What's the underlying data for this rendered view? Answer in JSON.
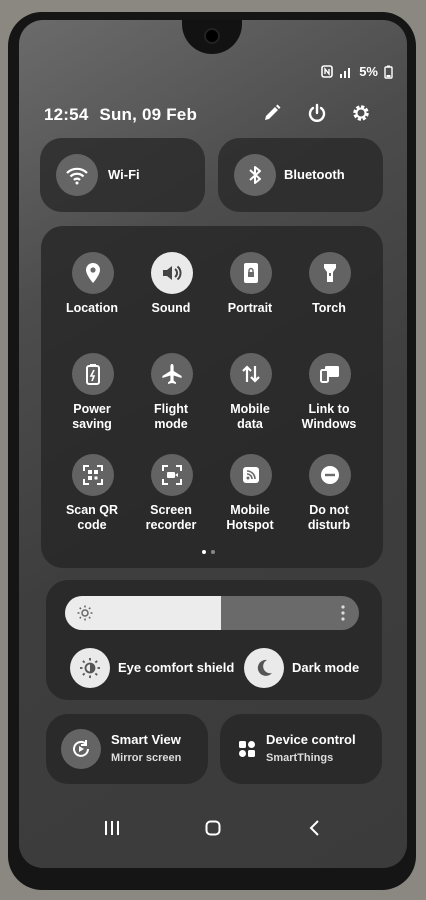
{
  "status_bar": {
    "battery": "5%",
    "icons": [
      "nfc-icon",
      "signal-icon",
      "battery-icon"
    ]
  },
  "header": {
    "time": "12:54",
    "date": "Sun, 09 Feb",
    "buttons": [
      "edit-icon",
      "power-icon",
      "settings-icon"
    ]
  },
  "top_toggles": [
    {
      "label": "Wi-Fi",
      "icon": "wifi-icon"
    },
    {
      "label": "Bluetooth",
      "icon": "bluetooth-icon"
    }
  ],
  "tiles": [
    {
      "label": "Location",
      "icon": "location-icon",
      "active": false
    },
    {
      "label": "Sound",
      "icon": "sound-icon",
      "active": true
    },
    {
      "label": "Portrait",
      "icon": "portrait-lock-icon",
      "active": false
    },
    {
      "label": "Torch",
      "icon": "torch-icon",
      "active": false
    },
    {
      "label": "Power\nsaving",
      "icon": "power-saving-icon",
      "active": false
    },
    {
      "label": "Flight\nmode",
      "icon": "airplane-icon",
      "active": false
    },
    {
      "label": "Mobile\ndata",
      "icon": "mobile-data-icon",
      "active": false
    },
    {
      "label": "Link to\nWindows",
      "icon": "link-to-windows-icon",
      "active": false
    },
    {
      "label": "Scan QR\ncode",
      "icon": "qr-icon",
      "active": false
    },
    {
      "label": "Screen\nrecorder",
      "icon": "screen-recorder-icon",
      "active": false
    },
    {
      "label": "Mobile\nHotspot",
      "icon": "hotspot-icon",
      "active": false
    },
    {
      "label": "Do not\ndisturb",
      "icon": "do-not-disturb-icon",
      "active": false
    }
  ],
  "page_indicator": {
    "pages": 2,
    "current": 1
  },
  "brightness": {
    "level": 0.53
  },
  "display_toggles": [
    {
      "label": "Eye comfort shield",
      "icon": "eye-comfort-icon"
    },
    {
      "label": "Dark mode",
      "icon": "dark-mode-icon"
    }
  ],
  "bottom_tiles": [
    {
      "title": "Smart View",
      "subtitle": "Mirror screen",
      "icon": "smart-view-icon"
    },
    {
      "title": "Device control",
      "subtitle": "SmartThings",
      "icon": "device-control-icon"
    }
  ],
  "nav": [
    "recent-apps-icon",
    "home-icon",
    "back-icon"
  ]
}
